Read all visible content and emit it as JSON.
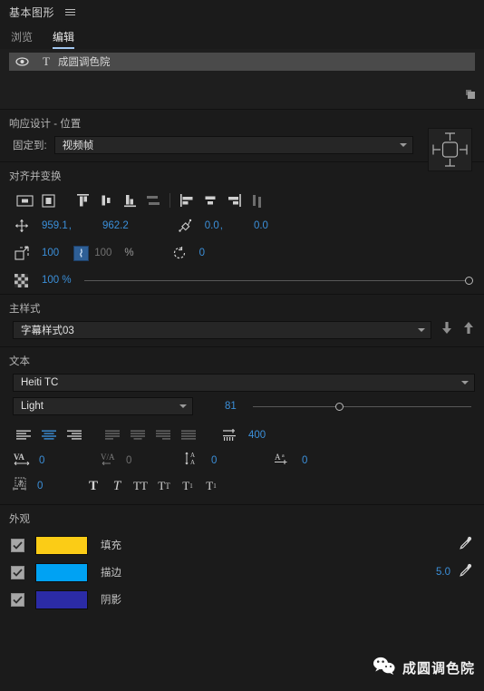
{
  "header": {
    "title": "基本图形",
    "menu_icon": "hamburger-menu-icon"
  },
  "tabs": [
    {
      "label": "浏览",
      "active": false
    },
    {
      "label": "编辑",
      "active": true
    }
  ],
  "layers": [
    {
      "name": "成圆调色院",
      "visible": true,
      "type_icon": "text-layer-icon",
      "selected": true
    }
  ],
  "responsive": {
    "section_title": "响应设计 - 位置",
    "pin_label": "固定到:",
    "pin_value": "视频帧",
    "pin_widget": "pin-box-widget"
  },
  "align": {
    "section_title": "对齐并变换",
    "buttons": [
      "align-horizontal-center-in-frame-icon",
      "align-vertical-center-in-frame-icon",
      "align-top-icon",
      "align-vertical-center-icon",
      "align-bottom-icon",
      "distribute-vertical-icon",
      "align-left-icon",
      "align-horizontal-center-icon",
      "align-right-icon",
      "distribute-horizontal-icon"
    ]
  },
  "transform": {
    "position_x": "959.1",
    "position_y": "962.2",
    "anchor_x": "0.0",
    "anchor_y": "0.0",
    "scale_x": "100",
    "scale_y": "100",
    "scale_unit": "%",
    "scale_linked": true,
    "rotation": "0",
    "opacity": "100 %",
    "opacity_slider_pct": 100
  },
  "master_style": {
    "section_title": "主样式",
    "value": "字幕样式03",
    "push_label": "push-to-style-icon",
    "pull_label": "pull-from-style-icon"
  },
  "text": {
    "section_title": "文本",
    "font_family": "Heiti TC",
    "font_style": "Light",
    "font_size": "81",
    "size_slider_pct": 40,
    "align_buttons": [
      "align-text-left-icon",
      "align-text-center-icon",
      "align-text-right-icon",
      "justify-last-left-icon",
      "justify-last-center-icon",
      "justify-last-right-icon",
      "justify-all-icon"
    ],
    "active_align_index": 1,
    "leading_icon": "leading-icon",
    "leading": "400",
    "tracking": "0",
    "kerning": "0",
    "line_spacing": "0",
    "baseline_shift": "0",
    "indent": "0",
    "style_buttons": [
      {
        "icon": "bold-icon",
        "glyph": "T"
      },
      {
        "icon": "italic-icon",
        "glyph": "T"
      },
      {
        "icon": "all-caps-icon",
        "glyph": "TT"
      },
      {
        "icon": "small-caps-icon",
        "glyph": "TT"
      },
      {
        "icon": "superscript-icon",
        "glyph": "T¹"
      },
      {
        "icon": "subscript-icon",
        "glyph": "T₁"
      }
    ]
  },
  "appearance": {
    "section_title": "外观",
    "rows": [
      {
        "label": "填充",
        "checked": true,
        "color": "#fbcc16",
        "value": "",
        "eyedropper": true
      },
      {
        "label": "描边",
        "checked": true,
        "color": "#00a2f3",
        "value": "5.0",
        "eyedropper": true
      },
      {
        "label": "阴影",
        "checked": true,
        "color": "#2b2ba6",
        "value": "",
        "eyedropper": false
      }
    ]
  },
  "watermark": {
    "icon": "wechat-icon",
    "text": "成圆调色院"
  },
  "colors": {
    "accent_blue": "#3b8fd9",
    "tab_underline": "#a3c7f0",
    "panel_bg": "#1b1b1b",
    "row_selected": "#4a4a4a"
  }
}
